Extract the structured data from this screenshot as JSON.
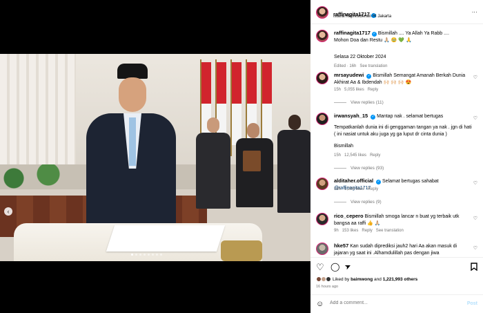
{
  "header": {
    "username": "raffinagita1717",
    "location": "Istana Kepresidenan RI Jakarta",
    "more": "..."
  },
  "caption": {
    "username": "raffinagita1717",
    "line1": "Bismillah .... Ya Allah Ya Rabb ....",
    "line2": "Mohon Doa dan Restu 🙏🏼 🥹 💚 🙏",
    "date": "Selasa 22 Oktober 2024",
    "edited": "Edited · 16h",
    "see_translation": "See translation"
  },
  "comments": [
    {
      "username": "mrsayudewi",
      "text": "Bismillah Semangat Amanah Berkah Dunia Akhirat Aa & Ibdendah 🙌🏻 🙌🏻 🙌🏻 😍",
      "time": "15h",
      "likes": "5,055 likes",
      "reply": "Reply",
      "view_replies": "View replies (11)"
    },
    {
      "username": "irwansyah_15",
      "text": "Mantap nak . selamat bertugas",
      "text2": "Tempatkanlah dunia ini di genggaman tangan ya nak . jgn di hati ( ini nasiat untuk aku juga yg ga luput dr cinta dunia )",
      "text3": "Bismillah",
      "time": "15h",
      "likes": "12,545 likes",
      "reply": "Reply",
      "view_replies": "View replies (93)"
    },
    {
      "username": "alditaher.official",
      "text": "Selamat bertugas sahabat",
      "mention": "@raffinagita1717",
      "time": "14h",
      "likes": "1,284 likes",
      "reply": "Reply",
      "view_replies": "View replies (9)"
    },
    {
      "username": "rico_cepero",
      "text": "Bismillah smoga lancar n buat yg terbaik utk bangsa aa raffi 👍 🙏🏼",
      "time": "9h",
      "likes": "153 likes",
      "reply": "Reply",
      "see_translation": "See translation"
    },
    {
      "username": "hke57",
      "text": "Kan sudah diprediksi jauh2 hari Aa akan masuk di jajaran yg saat ini .Alhamdulillah pas dengan jiwa"
    }
  ],
  "likes": {
    "prefix": "Liked by",
    "user": "baimwong",
    "and": "and",
    "count": "1,221,993 others"
  },
  "time_ago": "16 hours ago",
  "add_comment": {
    "placeholder": "Add a comment...",
    "post_label": "Post"
  },
  "icons": {
    "heart": "♡",
    "comment": "◯",
    "share": "➤",
    "bookmark": "🔖",
    "smiley": "☺",
    "prev": "‹"
  },
  "colors": {
    "verified": "#0095f6",
    "post_button": "#b2dffc",
    "flag_red": "#d1242d"
  }
}
